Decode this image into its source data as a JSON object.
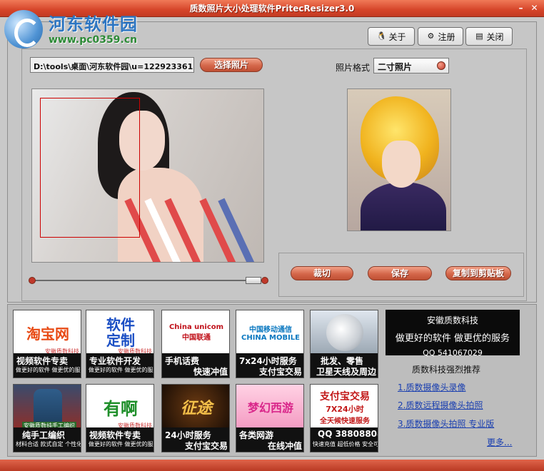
{
  "window": {
    "title": "质数照片大小处理软件PritecResizer3.0",
    "minimize": "–",
    "close": "✕"
  },
  "logo": {
    "name": "河东软件园",
    "url": "www.pc0359.cn"
  },
  "toolbar": {
    "about_label": "关于",
    "register_label": "注册",
    "close_label": "关闭"
  },
  "file": {
    "path_value": "D:\\tools\\桌面\\河东软件园\\u=1229233613,",
    "choose_label": "选择照片"
  },
  "format": {
    "label": "照片格式",
    "selected": "二寸照片"
  },
  "actions": {
    "crop_label": "裁切",
    "save_label": "保存",
    "copy_label": "复制到剪贴板"
  },
  "ads": {
    "tiles": [
      {
        "top": "淘宝网",
        "small": "安徽质数科技",
        "cap1": "视频软件专卖",
        "cap_small": "做更好的软件 做更优的服务"
      },
      {
        "top": "软件\n定制",
        "small": "安徽质数科技",
        "cap1": "专业软件开发",
        "cap_small": "做更好的软件 做更优的服务"
      },
      {
        "top": "China unicom 中国联通",
        "cap1": "手机话费",
        "cap2": "快速冲值"
      },
      {
        "top": "中国移动通信 CHINA MOBILE",
        "cap1": "7x24小时服务",
        "cap2": "支付宝交易"
      },
      {
        "top": "",
        "cap1": "批发、零售",
        "cap2": "卫星天线及周边"
      },
      {
        "top": "",
        "small": "安徽质数纯手工编织",
        "cap1": "纯手工编织",
        "cap_small": "材料合适 款式自定 个性化"
      },
      {
        "top": "有啊",
        "small": "安徽质数科技",
        "cap1": "视频软件专卖",
        "cap_small": "做更好的软件 做更优的服务"
      },
      {
        "top": "征途",
        "cap1": "24小时服务",
        "cap2": "支付宝交易"
      },
      {
        "top": "梦幻西游",
        "cap1": "各类网游",
        "cap2": "在线冲值"
      },
      {
        "top": "支付宝交易",
        "top2": "7X24小时",
        "top3": "全天候快速服务",
        "cap1": "QQ 38808808",
        "cap_small": "快速充值 超低价格 安全可靠"
      }
    ],
    "company": {
      "name": "安徽质数科技",
      "slogan": "做更好的软件  做更优的服务",
      "qq": "QQ  541067029"
    },
    "recommend_title": "质数科技强烈推荐",
    "links": [
      "1.质数摄像头录像",
      "2.质数远程摄像头拍照",
      "3.质数摄像头拍照 专业版"
    ],
    "more": "更多..."
  },
  "colors": {
    "accent": "#d4674a",
    "titlebar": "#d6452a",
    "link": "#1a3fb0",
    "crop_frame": "#cc0000"
  }
}
